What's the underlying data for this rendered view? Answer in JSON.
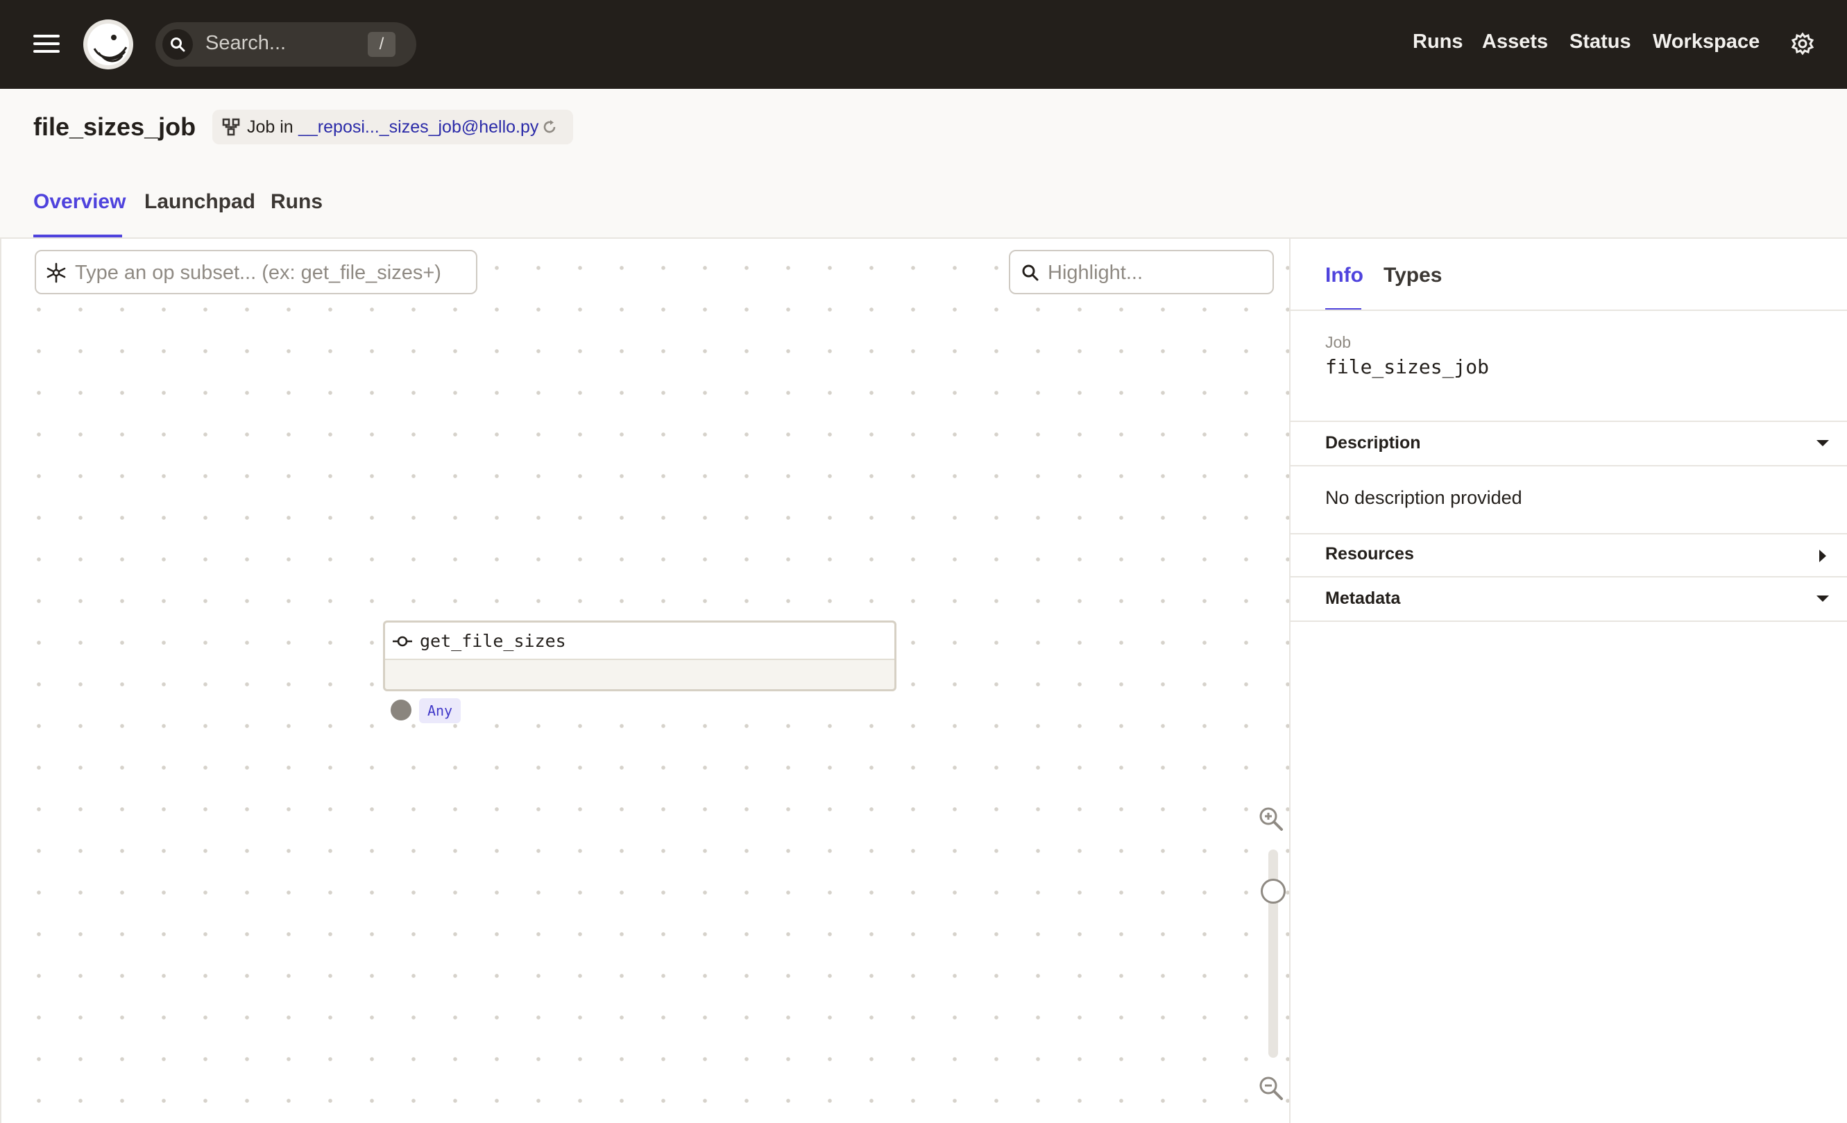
{
  "topbar": {
    "search_placeholder": "Search...",
    "search_shortcut": "/",
    "nav": [
      "Runs",
      "Assets",
      "Status",
      "Workspace"
    ]
  },
  "page": {
    "title": "file_sizes_job",
    "job_in_label": "Job in",
    "repo_link": "__reposi..._sizes_job@hello.py",
    "tabs": [
      "Overview",
      "Launchpad",
      "Runs"
    ],
    "active_tab": "Overview"
  },
  "graph": {
    "op_subset_placeholder": "Type an op subset... (ex: get_file_sizes+)",
    "highlight_placeholder": "Highlight...",
    "nodes": [
      {
        "name": "get_file_sizes",
        "output_type": "Any"
      }
    ],
    "zoom_level": 0.25
  },
  "sidebar": {
    "tabs": [
      "Info",
      "Types"
    ],
    "active_tab": "Info",
    "job_label": "Job",
    "job_name": "file_sizes_job",
    "sections": {
      "description": {
        "title": "Description",
        "body": "No description provided"
      },
      "resources": {
        "title": "Resources"
      },
      "metadata": {
        "title": "Metadata"
      }
    }
  },
  "colors": {
    "topbar_bg": "#231f1b",
    "accent": "#4f43dd",
    "link": "#2a2aa8"
  }
}
